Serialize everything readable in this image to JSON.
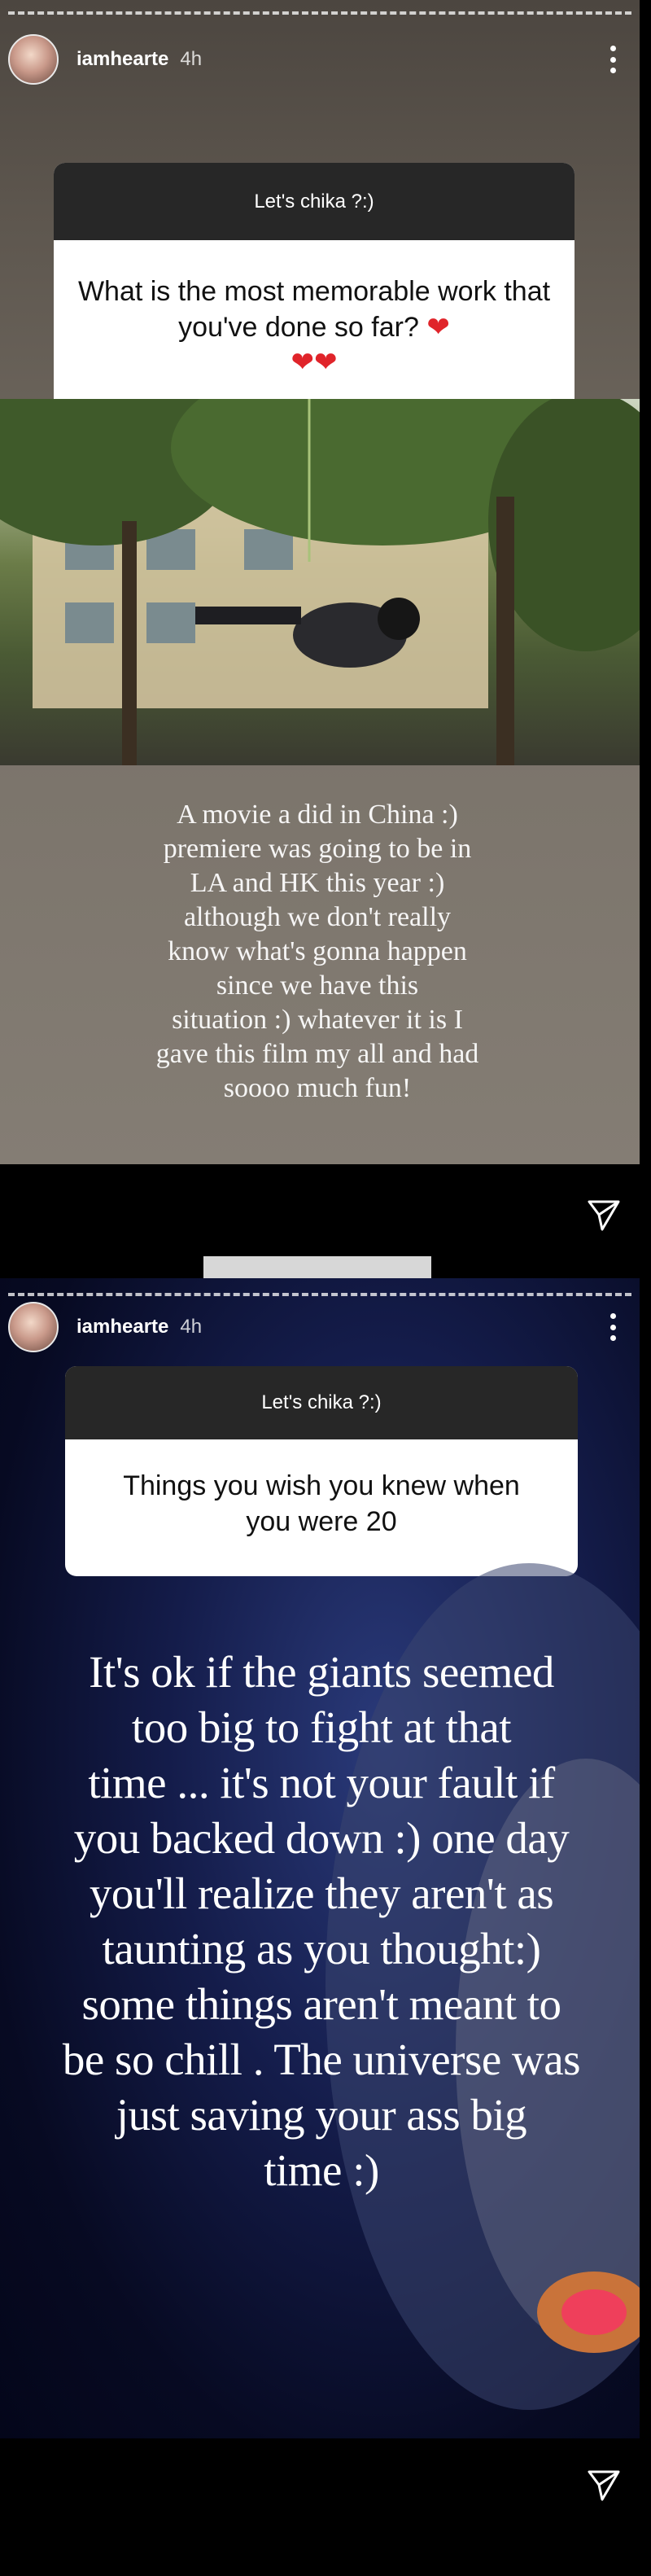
{
  "stories": [
    {
      "username": "iamhearte",
      "time": "4h",
      "question_title": "Let's chika ?:)",
      "question": "What is the most memorable work that you've done so far?",
      "hearts": "❤",
      "answer_lines": [
        "A movie a did in China :)",
        "premiere was going to be in",
        "LA and HK this year :)",
        "although we don't really",
        "know what's gonna happen",
        "since we have this",
        "situation :) whatever it is I",
        "gave this film my all and had",
        "soooo much fun!"
      ]
    },
    {
      "username": "iamhearte",
      "time": "4h",
      "question_title": "Let's chika ?:)",
      "question_lines": [
        "Things you wish you knew when",
        "you were 20"
      ],
      "answer_lines": [
        "It's ok if the giants seemed",
        "too big to fight at that",
        "time ... it's not your fault if",
        "you backed down  :) one day",
        "you'll realize they aren't as",
        "taunting as you thought:)",
        "some things aren't meant to",
        "be so chill . The universe was",
        "just saving your ass big",
        "time :)"
      ]
    }
  ],
  "icons": {
    "more": "more-vertical-icon",
    "send": "send-direct-icon"
  }
}
